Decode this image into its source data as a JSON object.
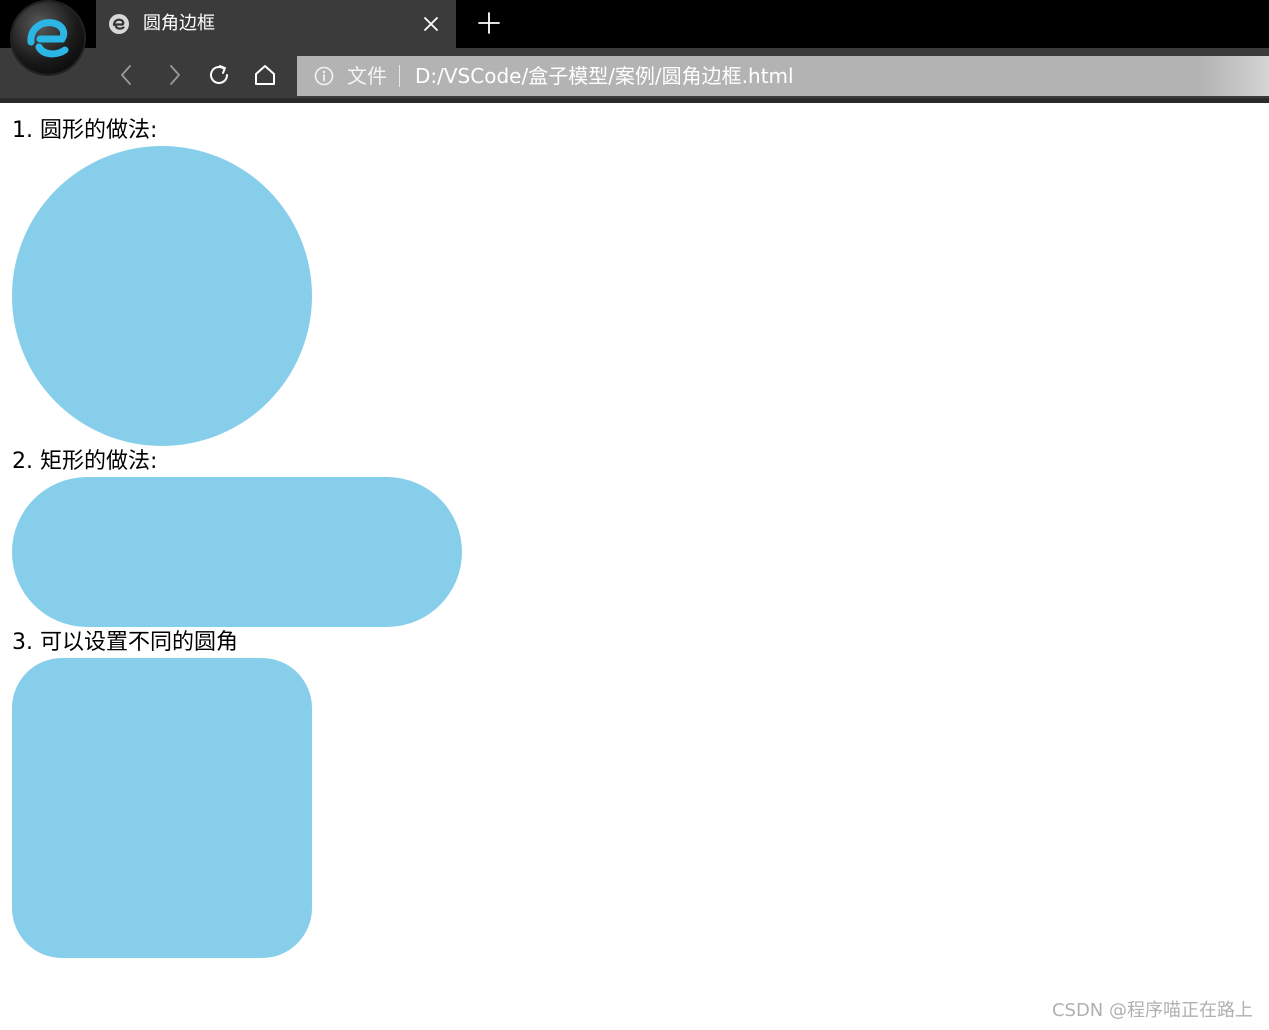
{
  "window": {
    "browser_logo_icon": "edge-logo-icon"
  },
  "tab": {
    "title": "圆角边框",
    "favicon_icon": "edge-favicon-icon",
    "close_icon": "close-icon"
  },
  "new_tab_icon": "plus-icon",
  "nav": {
    "back_icon": "chevron-left-icon",
    "forward_icon": "chevron-right-icon",
    "reload_icon": "reload-icon",
    "home_icon": "home-icon"
  },
  "address": {
    "info_icon": "info-icon",
    "scheme_label": "文件",
    "url": "D:/VSCode/盒子模型/案例/圆角边框.html"
  },
  "page": {
    "label_1": "1. 圆形的做法:",
    "label_2": "2. 矩形的做法:",
    "label_3": "3. 可以设置不同的圆角",
    "shape_color": "#87ceeb"
  },
  "watermark": "CSDN @程序喵正在路上",
  "colors": {
    "tabbar_bg": "#000000",
    "tab_bg": "#3b3b3b",
    "address_bg": "#b3b3b3",
    "logo_accent": "#2ab7e6"
  }
}
